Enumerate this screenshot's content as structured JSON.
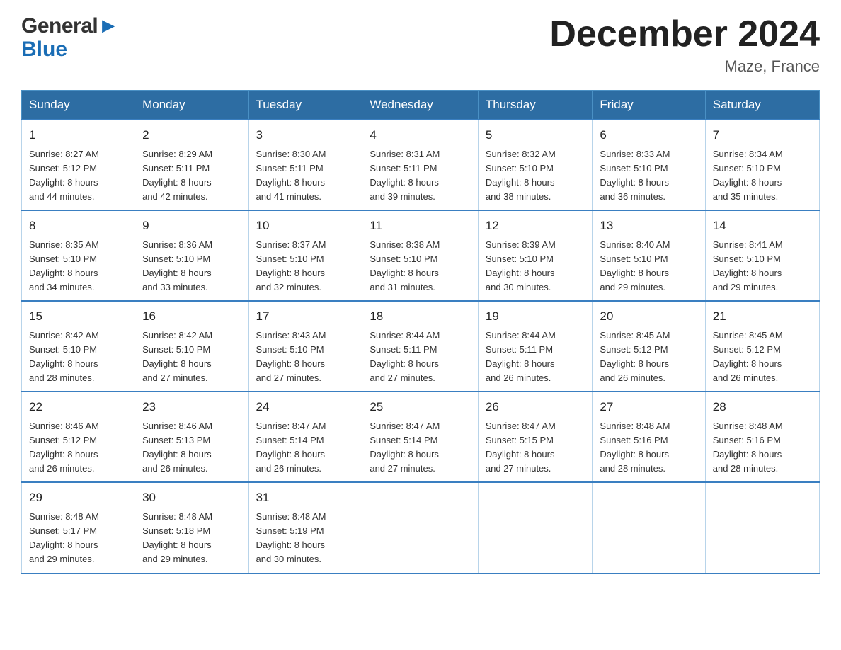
{
  "header": {
    "logo_line1": "General",
    "logo_line2": "Blue",
    "main_title": "December 2024",
    "subtitle": "Maze, France"
  },
  "calendar": {
    "days_of_week": [
      "Sunday",
      "Monday",
      "Tuesday",
      "Wednesday",
      "Thursday",
      "Friday",
      "Saturday"
    ],
    "weeks": [
      [
        {
          "day": "1",
          "sunrise": "8:27 AM",
          "sunset": "5:12 PM",
          "daylight": "8 hours and 44 minutes."
        },
        {
          "day": "2",
          "sunrise": "8:29 AM",
          "sunset": "5:11 PM",
          "daylight": "8 hours and 42 minutes."
        },
        {
          "day": "3",
          "sunrise": "8:30 AM",
          "sunset": "5:11 PM",
          "daylight": "8 hours and 41 minutes."
        },
        {
          "day": "4",
          "sunrise": "8:31 AM",
          "sunset": "5:11 PM",
          "daylight": "8 hours and 39 minutes."
        },
        {
          "day": "5",
          "sunrise": "8:32 AM",
          "sunset": "5:10 PM",
          "daylight": "8 hours and 38 minutes."
        },
        {
          "day": "6",
          "sunrise": "8:33 AM",
          "sunset": "5:10 PM",
          "daylight": "8 hours and 36 minutes."
        },
        {
          "day": "7",
          "sunrise": "8:34 AM",
          "sunset": "5:10 PM",
          "daylight": "8 hours and 35 minutes."
        }
      ],
      [
        {
          "day": "8",
          "sunrise": "8:35 AM",
          "sunset": "5:10 PM",
          "daylight": "8 hours and 34 minutes."
        },
        {
          "day": "9",
          "sunrise": "8:36 AM",
          "sunset": "5:10 PM",
          "daylight": "8 hours and 33 minutes."
        },
        {
          "day": "10",
          "sunrise": "8:37 AM",
          "sunset": "5:10 PM",
          "daylight": "8 hours and 32 minutes."
        },
        {
          "day": "11",
          "sunrise": "8:38 AM",
          "sunset": "5:10 PM",
          "daylight": "8 hours and 31 minutes."
        },
        {
          "day": "12",
          "sunrise": "8:39 AM",
          "sunset": "5:10 PM",
          "daylight": "8 hours and 30 minutes."
        },
        {
          "day": "13",
          "sunrise": "8:40 AM",
          "sunset": "5:10 PM",
          "daylight": "8 hours and 29 minutes."
        },
        {
          "day": "14",
          "sunrise": "8:41 AM",
          "sunset": "5:10 PM",
          "daylight": "8 hours and 29 minutes."
        }
      ],
      [
        {
          "day": "15",
          "sunrise": "8:42 AM",
          "sunset": "5:10 PM",
          "daylight": "8 hours and 28 minutes."
        },
        {
          "day": "16",
          "sunrise": "8:42 AM",
          "sunset": "5:10 PM",
          "daylight": "8 hours and 27 minutes."
        },
        {
          "day": "17",
          "sunrise": "8:43 AM",
          "sunset": "5:10 PM",
          "daylight": "8 hours and 27 minutes."
        },
        {
          "day": "18",
          "sunrise": "8:44 AM",
          "sunset": "5:11 PM",
          "daylight": "8 hours and 27 minutes."
        },
        {
          "day": "19",
          "sunrise": "8:44 AM",
          "sunset": "5:11 PM",
          "daylight": "8 hours and 26 minutes."
        },
        {
          "day": "20",
          "sunrise": "8:45 AM",
          "sunset": "5:12 PM",
          "daylight": "8 hours and 26 minutes."
        },
        {
          "day": "21",
          "sunrise": "8:45 AM",
          "sunset": "5:12 PM",
          "daylight": "8 hours and 26 minutes."
        }
      ],
      [
        {
          "day": "22",
          "sunrise": "8:46 AM",
          "sunset": "5:12 PM",
          "daylight": "8 hours and 26 minutes."
        },
        {
          "day": "23",
          "sunrise": "8:46 AM",
          "sunset": "5:13 PM",
          "daylight": "8 hours and 26 minutes."
        },
        {
          "day": "24",
          "sunrise": "8:47 AM",
          "sunset": "5:14 PM",
          "daylight": "8 hours and 26 minutes."
        },
        {
          "day": "25",
          "sunrise": "8:47 AM",
          "sunset": "5:14 PM",
          "daylight": "8 hours and 27 minutes."
        },
        {
          "day": "26",
          "sunrise": "8:47 AM",
          "sunset": "5:15 PM",
          "daylight": "8 hours and 27 minutes."
        },
        {
          "day": "27",
          "sunrise": "8:48 AM",
          "sunset": "5:16 PM",
          "daylight": "8 hours and 28 minutes."
        },
        {
          "day": "28",
          "sunrise": "8:48 AM",
          "sunset": "5:16 PM",
          "daylight": "8 hours and 28 minutes."
        }
      ],
      [
        {
          "day": "29",
          "sunrise": "8:48 AM",
          "sunset": "5:17 PM",
          "daylight": "8 hours and 29 minutes."
        },
        {
          "day": "30",
          "sunrise": "8:48 AM",
          "sunset": "5:18 PM",
          "daylight": "8 hours and 29 minutes."
        },
        {
          "day": "31",
          "sunrise": "8:48 AM",
          "sunset": "5:19 PM",
          "daylight": "8 hours and 30 minutes."
        },
        null,
        null,
        null,
        null
      ]
    ],
    "labels": {
      "sunrise": "Sunrise:",
      "sunset": "Sunset:",
      "daylight": "Daylight:"
    }
  }
}
